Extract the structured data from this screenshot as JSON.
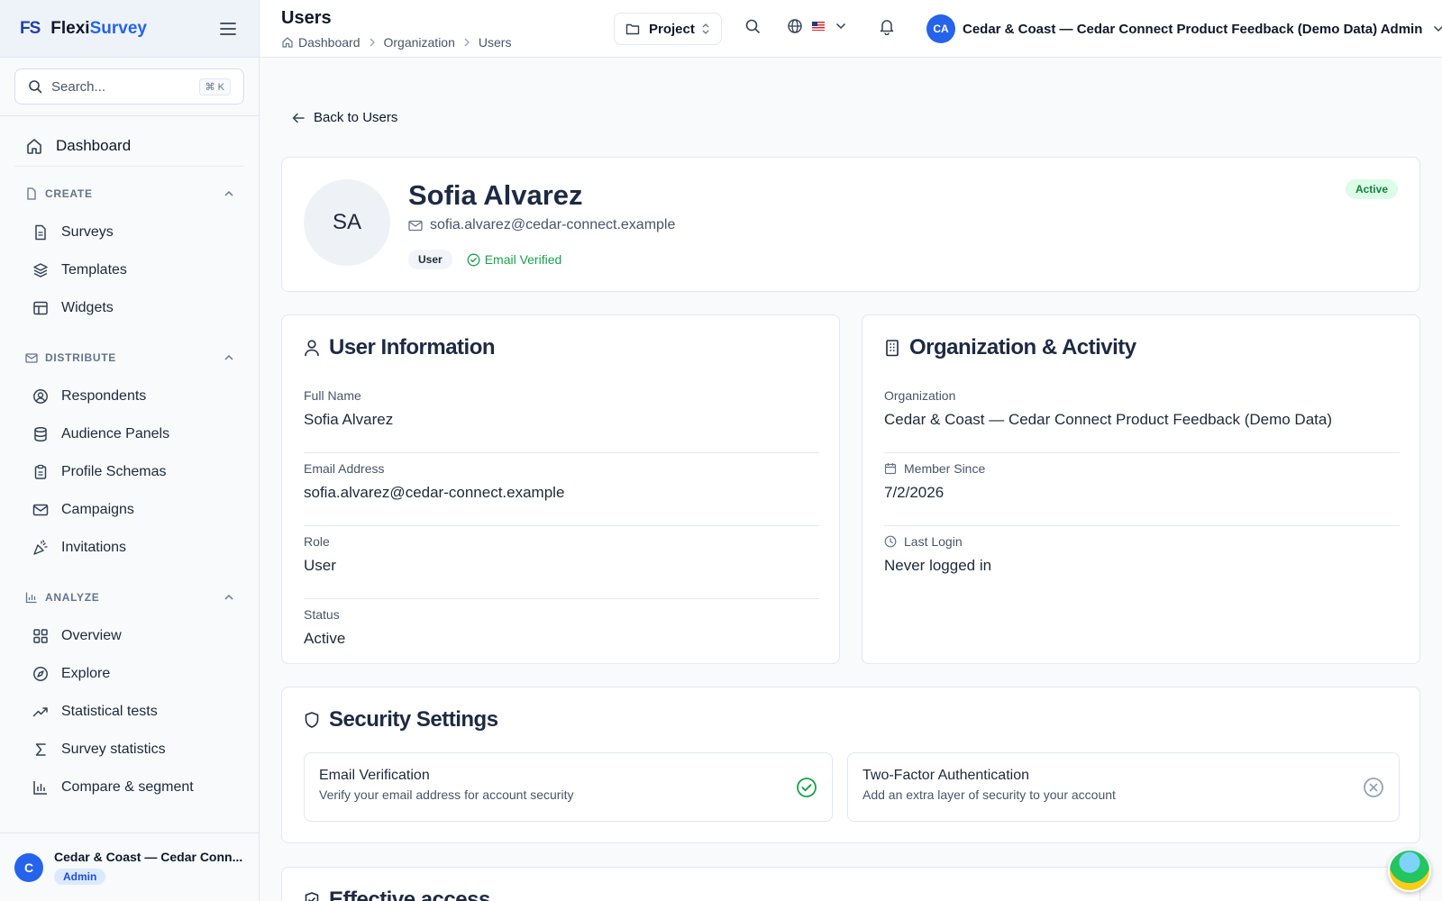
{
  "brand": {
    "logo": "FS",
    "name_part1": "Flexi",
    "name_part2": "Survey"
  },
  "sidebar": {
    "search_placeholder": "Search...",
    "search_shortcut": "⌘ K",
    "dashboard": "Dashboard",
    "sections": [
      {
        "title": "CREATE",
        "items": [
          "Surveys",
          "Templates",
          "Widgets"
        ]
      },
      {
        "title": "DISTRIBUTE",
        "items": [
          "Respondents",
          "Audience Panels",
          "Profile Schemas",
          "Campaigns",
          "Invitations"
        ]
      },
      {
        "title": "ANALYZE",
        "items": [
          "Overview",
          "Explore",
          "Statistical tests",
          "Survey statistics",
          "Compare & segment"
        ]
      }
    ],
    "user": {
      "initial": "C",
      "name": "Cedar & Coast — Cedar Conn...",
      "role": "Admin"
    }
  },
  "header": {
    "title": "Users",
    "breadcrumbs": [
      "Dashboard",
      "Organization",
      "Users"
    ],
    "project_label": "Project",
    "user_initials": "CA",
    "user_name": "Cedar & Coast — Cedar Connect Product Feedback (Demo Data) Admin"
  },
  "main": {
    "back_label": "Back to Users",
    "profile": {
      "initials": "SA",
      "name": "Sofia Alvarez",
      "email": "sofia.alvarez@cedar-connect.example",
      "role_tag": "User",
      "verified_label": "Email Verified",
      "status": "Active"
    },
    "user_info": {
      "title": "User Information",
      "fields": [
        {
          "label": "Full Name",
          "value": "Sofia Alvarez"
        },
        {
          "label": "Email Address",
          "value": "sofia.alvarez@cedar-connect.example"
        },
        {
          "label": "Role",
          "value": "User"
        },
        {
          "label": "Status",
          "value": "Active"
        }
      ]
    },
    "org_activity": {
      "title": "Organization & Activity",
      "fields": [
        {
          "label": "Organization",
          "value": "Cedar & Coast — Cedar Connect Product Feedback (Demo Data)"
        },
        {
          "label": "Member Since",
          "value": "7/2/2026"
        },
        {
          "label": "Last Login",
          "value": "Never logged in"
        }
      ]
    },
    "security": {
      "title": "Security Settings",
      "email_verification": {
        "title": "Email Verification",
        "desc": "Verify your email address for account security"
      },
      "two_factor": {
        "title": "Two-Factor Authentication",
        "desc": "Add an extra layer of security to your account"
      }
    },
    "access": {
      "title": "Effective access"
    }
  },
  "colors": {
    "primary": "#2563eb",
    "success": "#16a34a",
    "muted": "#475569"
  }
}
